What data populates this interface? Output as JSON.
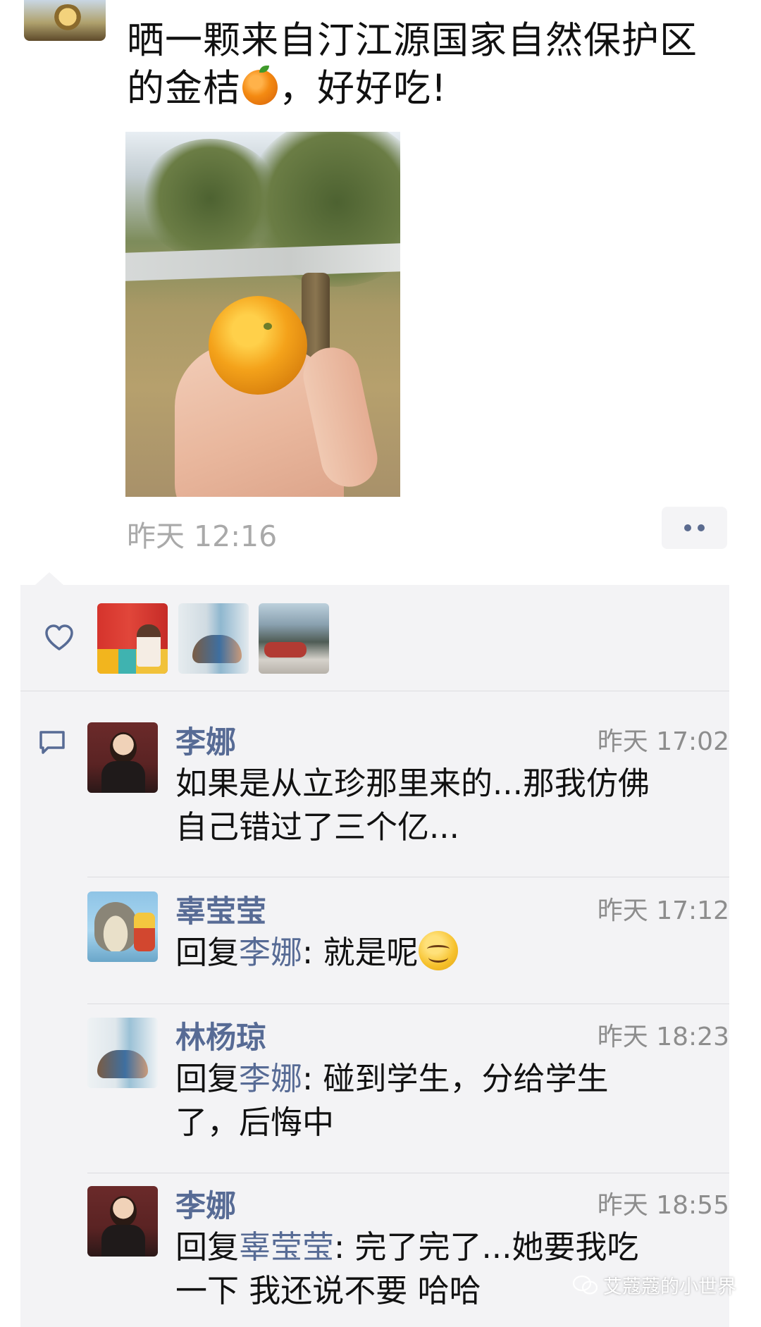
{
  "post": {
    "text_line1": "晒一颗来自汀江源国家自然保护区",
    "text_line2_before": "的金桔",
    "text_line2_after": "，好好吃!",
    "time": "昨天 12:16"
  },
  "likes": {
    "icon": "heart-outline-icon",
    "count_shown": 3
  },
  "comments": [
    {
      "author": "李娜",
      "time": "昨天 17:02",
      "lines": [
        "如果是从立珍那里来的...那我仿佛",
        "自己错过了三个亿..."
      ]
    },
    {
      "author": "辜莹莹",
      "time": "昨天 17:12",
      "reply_prefix": "回复",
      "reply_to": "李娜",
      "text": ": 就是呢"
    },
    {
      "author": "林杨琼",
      "time": "昨天 18:23",
      "reply_prefix": "回复",
      "reply_to": "李娜",
      "text_line1": ": 碰到学生，分给学生",
      "text_line2": "了，后悔中"
    },
    {
      "author": "李娜",
      "time": "昨天 18:55",
      "reply_prefix": "回复",
      "reply_to": "辜莹莹",
      "text_line1": ": 完了完了...她要我吃",
      "text_line2": "一下 我还说不要 哈哈"
    }
  ],
  "watermark": "艾蔻蔻的小世界",
  "colors": {
    "name_link": "#576b95",
    "panel_bg": "#f3f3f5",
    "timestamp": "#a9a9a9"
  }
}
